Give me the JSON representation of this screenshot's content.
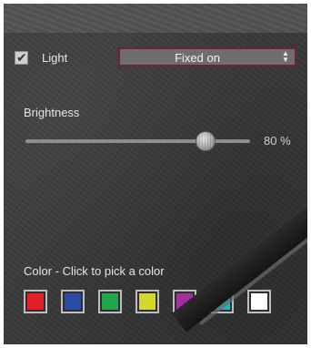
{
  "light": {
    "label": "Light",
    "checked": true
  },
  "mode": {
    "selected": "Fixed on"
  },
  "brightness": {
    "label": "Brightness",
    "level": 80,
    "value_text": "80 %"
  },
  "color": {
    "caption": "Color  -  Click to pick a color",
    "swatches": [
      {
        "name": "red",
        "hex": "#e3202a"
      },
      {
        "name": "blue",
        "hex": "#2a4aa8"
      },
      {
        "name": "green",
        "hex": "#1fa84a"
      },
      {
        "name": "yellow",
        "hex": "#d4d82a"
      },
      {
        "name": "purple",
        "hex": "#a0309c"
      },
      {
        "name": "cyan",
        "hex": "#18b8c0"
      },
      {
        "name": "white",
        "hex": "#ffffff"
      }
    ]
  },
  "accent": "#6b2430"
}
